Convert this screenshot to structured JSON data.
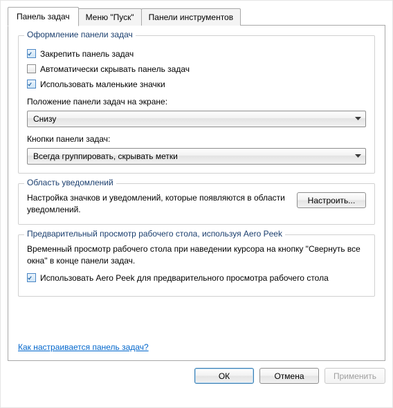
{
  "tabs": {
    "taskbar": "Панель задач",
    "start": "Меню \"Пуск\"",
    "toolbars": "Панели инструментов"
  },
  "group_appearance": {
    "legend": "Оформление панели задач",
    "lock": "Закрепить панель задач",
    "autohide": "Автоматически скрывать панель задач",
    "small": "Использовать маленькие значки",
    "position_label": "Положение панели задач на экране:",
    "position_value": "Снизу",
    "buttons_label": "Кнопки панели задач:",
    "buttons_value": "Всегда группировать, скрывать метки"
  },
  "group_notify": {
    "legend": "Область уведомлений",
    "desc": "Настройка значков и уведомлений, которые появляются в области уведомлений.",
    "btn": "Настроить..."
  },
  "group_peek": {
    "legend": "Предварительный просмотр рабочего стола, используя Aero Peek",
    "desc": "Временный просмотр рабочего стола при наведении курсора на кнопку \"Свернуть все окна\" в конце панели задач.",
    "cb": "Использовать Aero Peek для предварительного просмотра рабочего стола"
  },
  "help_link": "Как настраивается панель задач?",
  "buttons": {
    "ok": "ОК",
    "cancel": "Отмена",
    "apply": "Применить"
  }
}
